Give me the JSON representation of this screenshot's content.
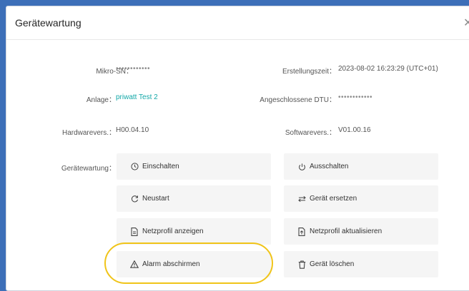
{
  "dialog": {
    "title": "Gerätewartung",
    "close_glyph": "✕"
  },
  "fields": {
    "mikro_sn": {
      "label": "Mikro-SN：",
      "value": "••••••••••••"
    },
    "erstellungszeit": {
      "label": "Erstellungszeit：",
      "value": "2023-08-02 16:23:29 (UTC+01)"
    },
    "anlage": {
      "label": "Anlage：",
      "value": "priwatt Test 2"
    },
    "dtu": {
      "label": "Angeschlossene DTU：",
      "value": "••••••••••••"
    },
    "hardware": {
      "label": "Hardwarevers.：",
      "value": "H00.04.10"
    },
    "software": {
      "label": "Softwarevers.：",
      "value": "V01.00.16"
    },
    "wartung": {
      "label": "Gerätewartung："
    }
  },
  "actions": {
    "einschalten": {
      "label": "Einschalten",
      "icon": "clock-icon"
    },
    "ausschalten": {
      "label": "Ausschalten",
      "icon": "power-icon"
    },
    "neustart": {
      "label": "Neustart",
      "icon": "restart-icon"
    },
    "ersetzen": {
      "label": "Gerät ersetzen",
      "icon": "swap-icon"
    },
    "netzprofil_anzeigen": {
      "label": "Netzprofil anzeigen",
      "icon": "document-icon"
    },
    "netzprofil_aktualisieren": {
      "label": "Netzprofil aktualisieren",
      "icon": "document-upload-icon"
    },
    "alarm": {
      "label": "Alarm abschirmen",
      "icon": "warning-icon"
    },
    "loeschen": {
      "label": "Gerät löschen",
      "icon": "trash-icon"
    }
  },
  "colors": {
    "link": "#13a8a8",
    "highlight": "#f0c419",
    "button_bg": "#f5f5f5"
  }
}
